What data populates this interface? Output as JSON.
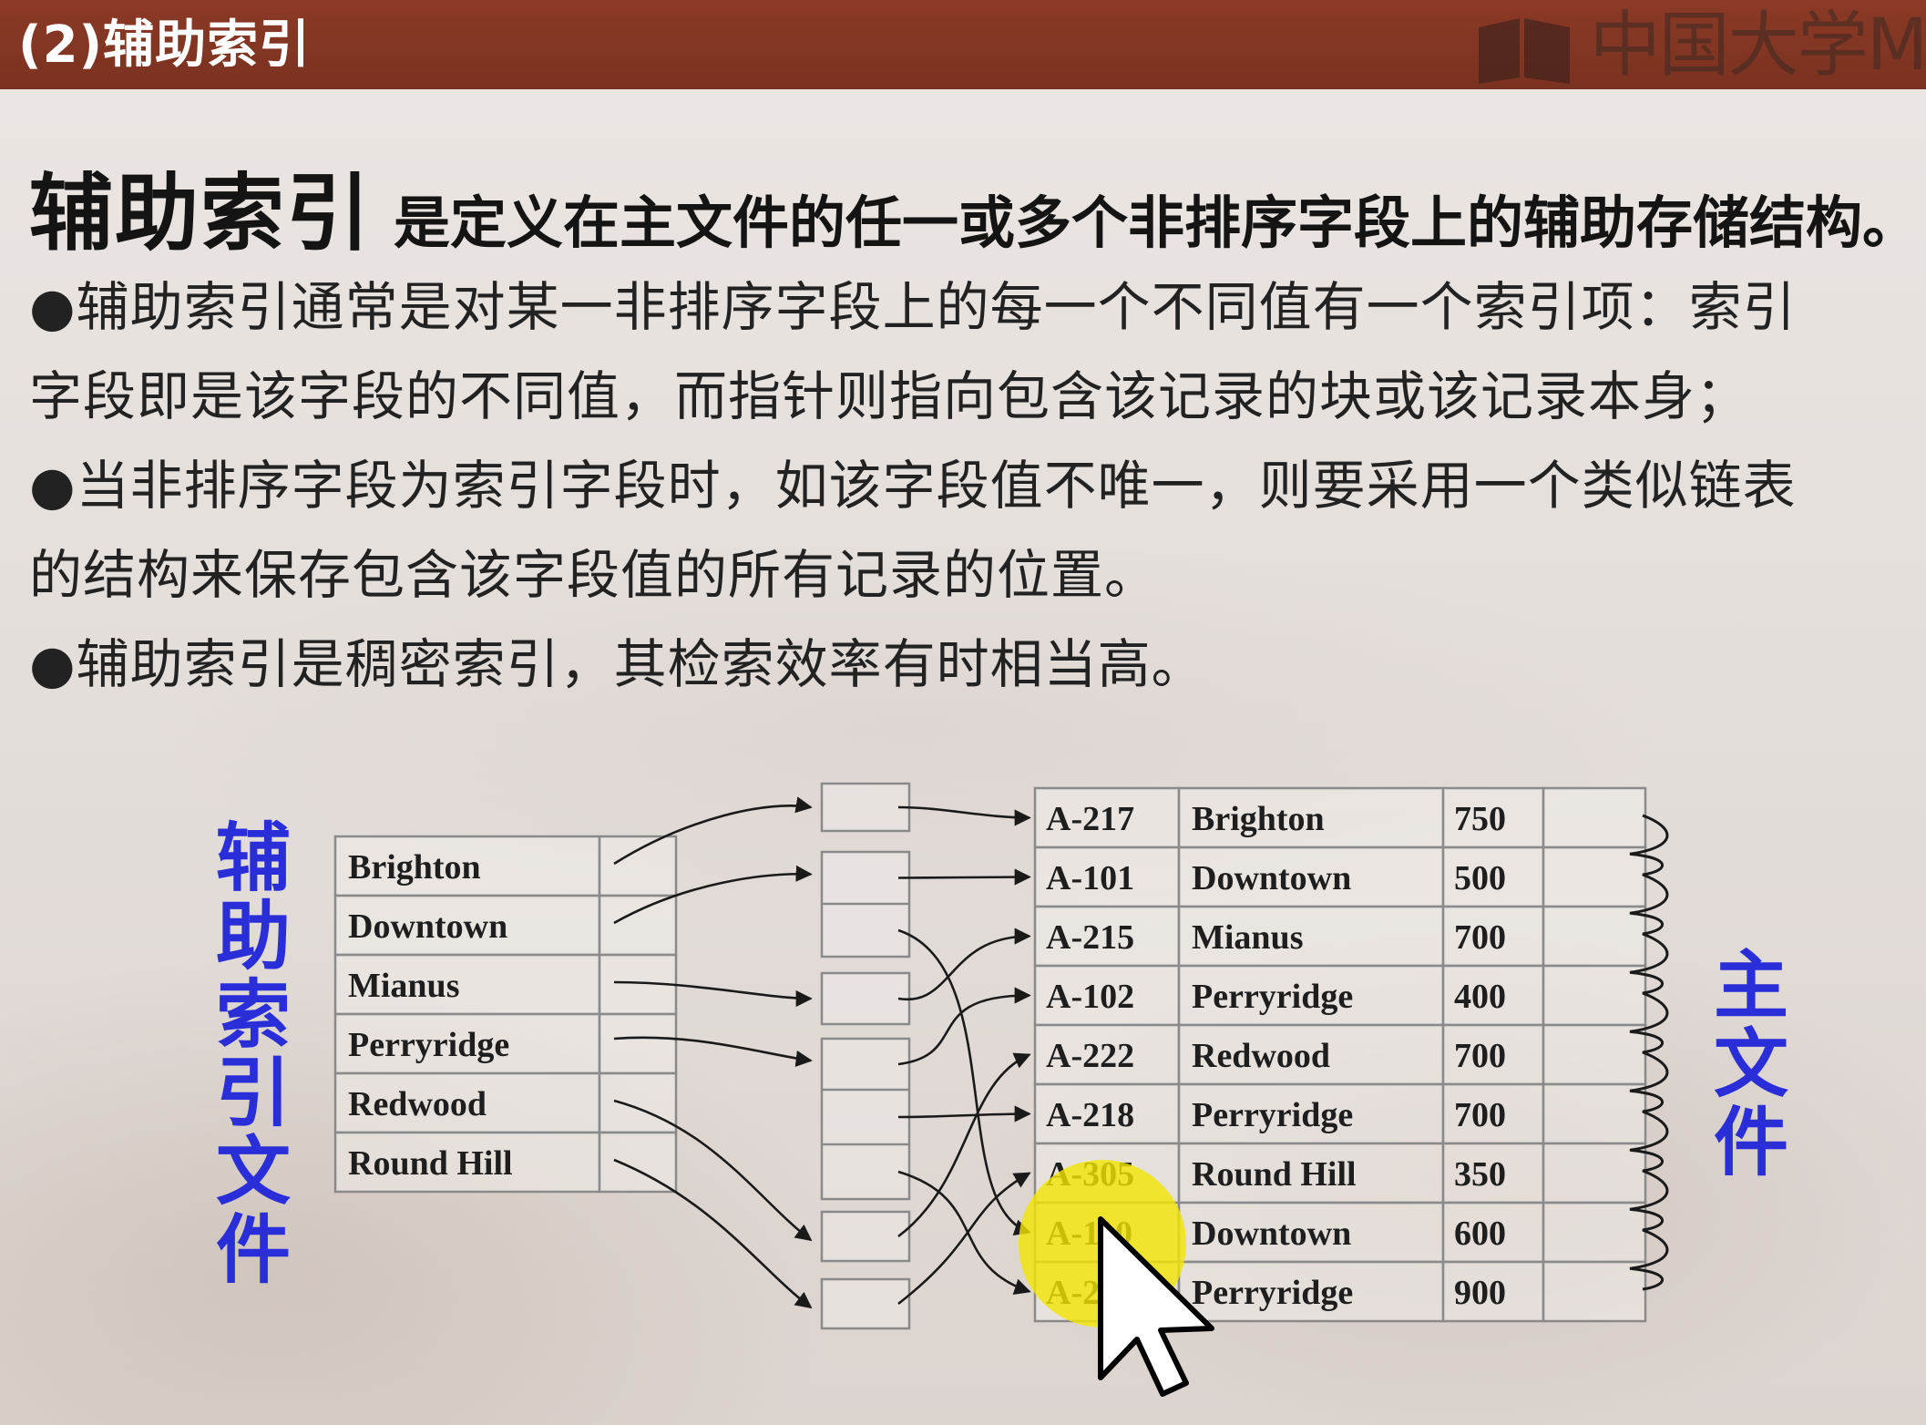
{
  "header": {
    "title": "(2)辅助索引",
    "logo_text": "中国大学M"
  },
  "definition": {
    "term": "辅助索引",
    "text": "是定义在主文件的任一或多个非排序字段上的辅助存储结构。"
  },
  "bullets": [
    {
      "line1": "●辅助索引通常是对某一非排序字段上的每一个不同值有一个索引项：索引",
      "line2": "字段即是该字段的不同值，而指针则指向包含该记录的块或该记录本身；"
    },
    {
      "line1": "●当非排序字段为索引字段时，如该字段值不唯一，则要采用一个类似链表",
      "line2": "的结构来保存包含该字段值的所有记录的位置。"
    },
    {
      "line1": "●辅助索引是稠密索引，其检索效率有时相当高。"
    }
  ],
  "diagram": {
    "left_label": "辅助索引文件",
    "right_label": "主文件",
    "index_keys": [
      "Brighton",
      "Downtown",
      "Mianus",
      "Perryridge",
      "Redwood",
      "Round Hill"
    ],
    "main_records": [
      [
        "A-217",
        "Brighton",
        "750"
      ],
      [
        "A-101",
        "Downtown",
        "500"
      ],
      [
        "A-215",
        "Mianus",
        "700"
      ],
      [
        "A-102",
        "Perryridge",
        "400"
      ],
      [
        "A-222",
        "Redwood",
        "700"
      ],
      [
        "A-218",
        "Perryridge",
        "700"
      ],
      [
        "A-305",
        "Round Hill",
        "350"
      ],
      [
        "A-110",
        "Downtown",
        "600"
      ],
      [
        "A-201",
        "Perryridge",
        "900"
      ]
    ],
    "colors": {
      "label_blue": "#2a2ed8",
      "highlight_yellow": "#f2e600",
      "grid": "#8a8a8a",
      "arrow": "#1a1a1a"
    },
    "cursor_icon": "mouse-pointer-icon"
  }
}
